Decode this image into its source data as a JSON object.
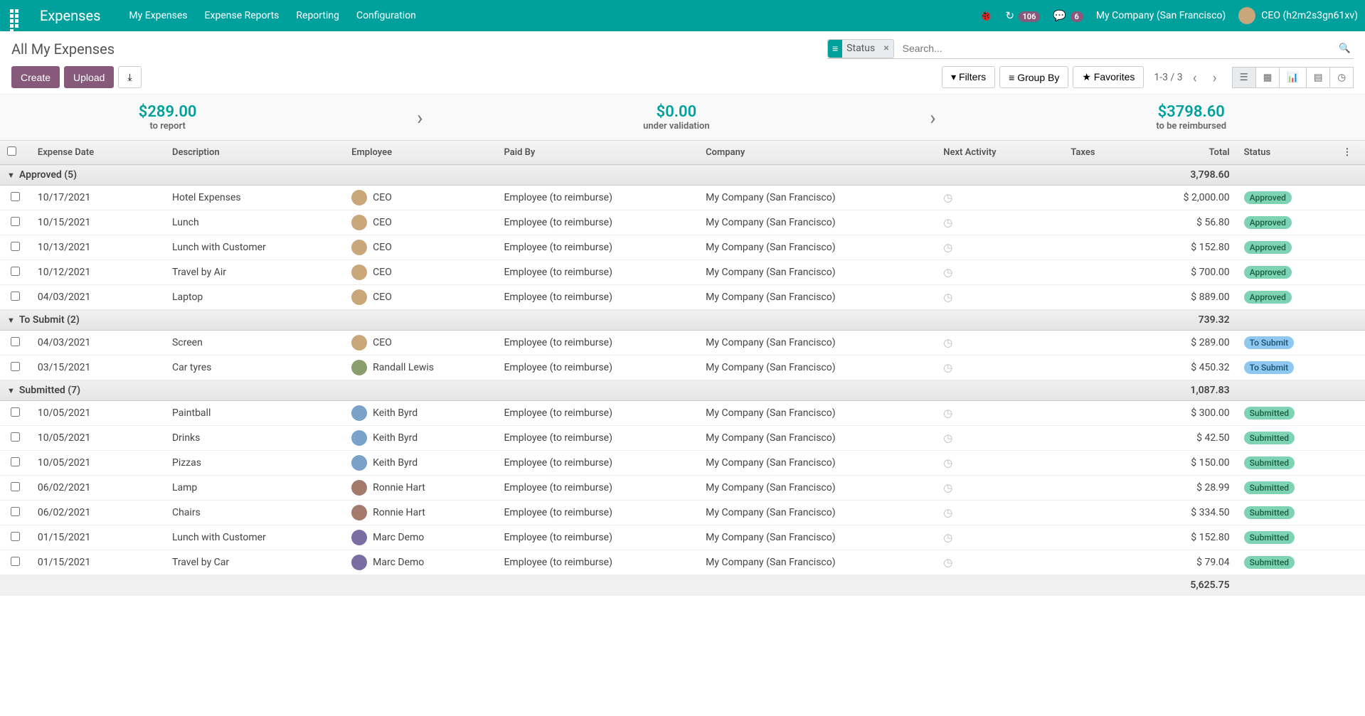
{
  "header": {
    "brand": "Expenses",
    "menu": [
      "My Expenses",
      "Expense Reports",
      "Reporting",
      "Configuration"
    ],
    "debug_badge": "106",
    "chat_badge": "6",
    "company": "My Company (San Francisco)",
    "user": "CEO (h2m2s3gn61xv)"
  },
  "page": {
    "title": "All My Expenses",
    "facet_label": "Status",
    "search_placeholder": "Search...",
    "create_label": "Create",
    "upload_label": "Upload",
    "filters_label": "Filters",
    "groupby_label": "Group By",
    "favorites_label": "Favorites",
    "pager_value": "1-3 / 3"
  },
  "dashboard": {
    "to_report_value": "$289.00",
    "to_report_label": "to report",
    "under_validation_value": "$0.00",
    "under_validation_label": "under validation",
    "reimbursed_value": "$3798.60",
    "reimbursed_label": "to be reimbursed"
  },
  "columns": {
    "date": "Expense Date",
    "description": "Description",
    "employee": "Employee",
    "paid_by": "Paid By",
    "company": "Company",
    "activity": "Next Activity",
    "taxes": "Taxes",
    "total": "Total",
    "status": "Status"
  },
  "groups": [
    {
      "title": "Approved (5)",
      "total": "3,798.60",
      "rows": [
        {
          "date": "10/17/2021",
          "desc": "Hotel Expenses",
          "emp": "CEO",
          "avatar": "1",
          "paid": "Employee (to reimburse)",
          "company": "My Company (San Francisco)",
          "total": "$ 2,000.00",
          "status": "Approved",
          "status_class": "approved"
        },
        {
          "date": "10/15/2021",
          "desc": "Lunch",
          "emp": "CEO",
          "avatar": "1",
          "paid": "Employee (to reimburse)",
          "company": "My Company (San Francisco)",
          "total": "$ 56.80",
          "status": "Approved",
          "status_class": "approved"
        },
        {
          "date": "10/13/2021",
          "desc": "Lunch with Customer",
          "emp": "CEO",
          "avatar": "1",
          "paid": "Employee (to reimburse)",
          "company": "My Company (San Francisco)",
          "total": "$ 152.80",
          "status": "Approved",
          "status_class": "approved"
        },
        {
          "date": "10/12/2021",
          "desc": "Travel by Air",
          "emp": "CEO",
          "avatar": "1",
          "paid": "Employee (to reimburse)",
          "company": "My Company (San Francisco)",
          "total": "$ 700.00",
          "status": "Approved",
          "status_class": "approved"
        },
        {
          "date": "04/03/2021",
          "desc": "Laptop",
          "emp": "CEO",
          "avatar": "1",
          "paid": "Employee (to reimburse)",
          "company": "My Company (San Francisco)",
          "total": "$ 889.00",
          "status": "Approved",
          "status_class": "approved"
        }
      ]
    },
    {
      "title": "To Submit (2)",
      "total": "739.32",
      "rows": [
        {
          "date": "04/03/2021",
          "desc": "Screen",
          "emp": "CEO",
          "avatar": "1",
          "paid": "Employee (to reimburse)",
          "company": "My Company (San Francisco)",
          "total": "$ 289.00",
          "status": "To Submit",
          "status_class": "tosubmit"
        },
        {
          "date": "03/15/2021",
          "desc": "Car tyres",
          "emp": "Randall Lewis",
          "avatar": "3",
          "paid": "Employee (to reimburse)",
          "company": "My Company (San Francisco)",
          "total": "$ 450.32",
          "status": "To Submit",
          "status_class": "tosubmit"
        }
      ]
    },
    {
      "title": "Submitted (7)",
      "total": "1,087.83",
      "rows": [
        {
          "date": "10/05/2021",
          "desc": "Paintball",
          "emp": "Keith Byrd",
          "avatar": "2",
          "paid": "Employee (to reimburse)",
          "company": "My Company (San Francisco)",
          "total": "$ 300.00",
          "status": "Submitted",
          "status_class": "submitted"
        },
        {
          "date": "10/05/2021",
          "desc": "Drinks",
          "emp": "Keith Byrd",
          "avatar": "2",
          "paid": "Employee (to reimburse)",
          "company": "My Company (San Francisco)",
          "total": "$ 42.50",
          "status": "Submitted",
          "status_class": "submitted"
        },
        {
          "date": "10/05/2021",
          "desc": "Pizzas",
          "emp": "Keith Byrd",
          "avatar": "2",
          "paid": "Employee (to reimburse)",
          "company": "My Company (San Francisco)",
          "total": "$ 150.00",
          "status": "Submitted",
          "status_class": "submitted"
        },
        {
          "date": "06/02/2021",
          "desc": "Lamp",
          "emp": "Ronnie Hart",
          "avatar": "4",
          "paid": "Employee (to reimburse)",
          "company": "My Company (San Francisco)",
          "total": "$ 28.99",
          "status": "Submitted",
          "status_class": "submitted"
        },
        {
          "date": "06/02/2021",
          "desc": "Chairs",
          "emp": "Ronnie Hart",
          "avatar": "4",
          "paid": "Employee (to reimburse)",
          "company": "My Company (San Francisco)",
          "total": "$ 334.50",
          "status": "Submitted",
          "status_class": "submitted"
        },
        {
          "date": "01/15/2021",
          "desc": "Lunch with Customer",
          "emp": "Marc Demo",
          "avatar": "5",
          "paid": "Employee (to reimburse)",
          "company": "My Company (San Francisco)",
          "total": "$ 152.80",
          "status": "Submitted",
          "status_class": "submitted"
        },
        {
          "date": "01/15/2021",
          "desc": "Travel by Car",
          "emp": "Marc Demo",
          "avatar": "5",
          "paid": "Employee (to reimburse)",
          "company": "My Company (San Francisco)",
          "total": "$ 79.04",
          "status": "Submitted",
          "status_class": "submitted"
        }
      ]
    }
  ],
  "grand_total": "5,625.75"
}
